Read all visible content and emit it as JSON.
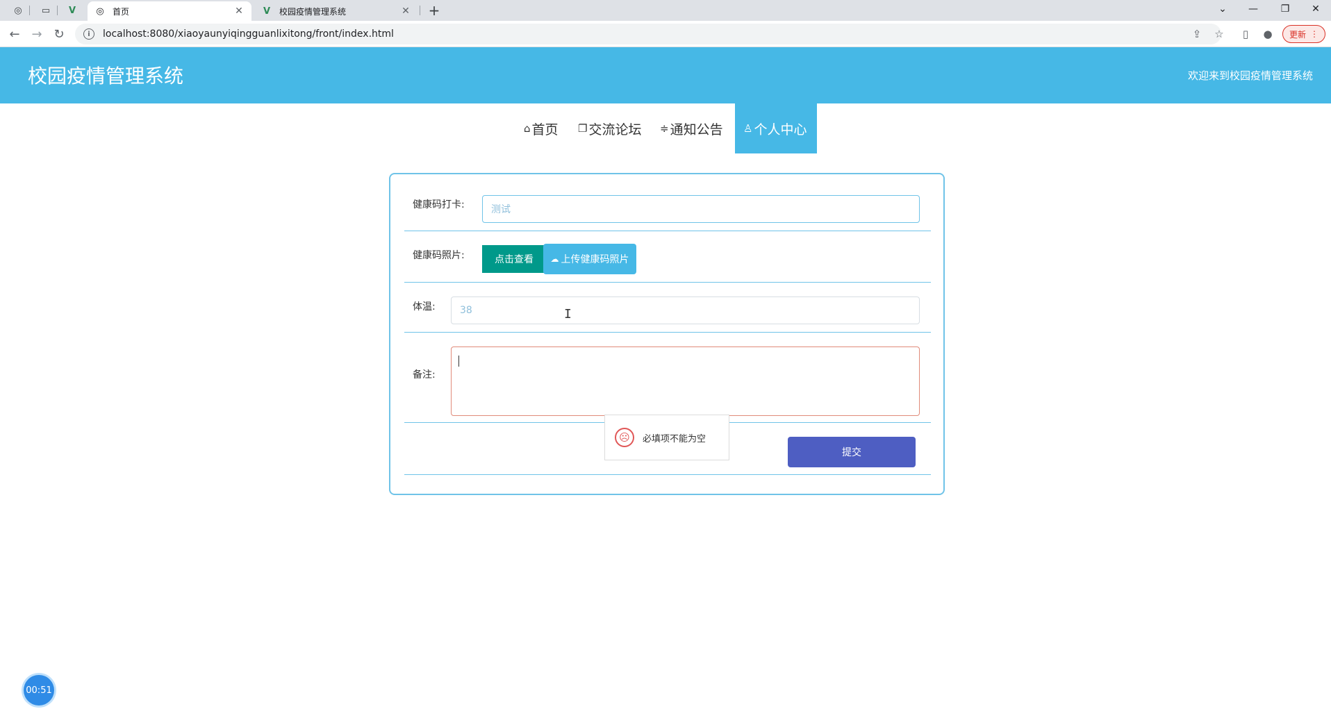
{
  "browser": {
    "tabs": [
      {
        "title": "首页",
        "active": true
      },
      {
        "title": "校园疫情管理系统",
        "active": false
      }
    ],
    "new_tab_label": "+",
    "url": "localhost:8080/xiaoyaunyiqingguanlixitong/front/index.html",
    "update_label": "更新"
  },
  "header": {
    "title": "校园疫情管理系统",
    "welcome": "欢迎来到校园疫情管理系统"
  },
  "nav": {
    "items": [
      {
        "label": "首页",
        "icon": "home-icon"
      },
      {
        "label": "交流论坛",
        "icon": "book-icon"
      },
      {
        "label": "通知公告",
        "icon": "filter-icon"
      },
      {
        "label": "个人中心",
        "icon": "user-icon",
        "active": true
      }
    ]
  },
  "form": {
    "health_code_label": "健康码打卡:",
    "health_code_value": "测试",
    "photo_label": "健康码照片:",
    "view_button": "点击查看",
    "upload_button": "上传健康码照片",
    "temperature_label": "体温:",
    "temperature_value": "38",
    "remark_label": "备注:",
    "submit_button": "提交",
    "error_message": "必填项不能为空"
  },
  "timer": {
    "value": "00:51"
  },
  "colors": {
    "primary": "#46b8e6",
    "teal": "#00998a",
    "submit": "#4e5ec2",
    "error": "#e05656"
  }
}
